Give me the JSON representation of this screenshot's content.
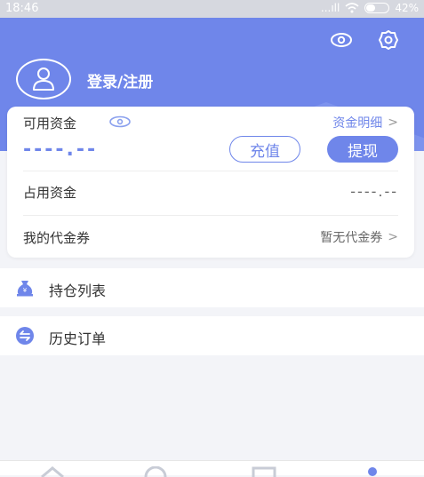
{
  "status_bar": {
    "time": "18:46",
    "signal": "...ıll",
    "battery_text": "42%",
    "battery_level": 0.42
  },
  "header": {
    "login_text": "登录/注册"
  },
  "funds": {
    "available_label": "可用资金",
    "detail_link": "资金明细",
    "available_value": "----.--",
    "recharge_button": "充值",
    "withdraw_button": "提现",
    "occupied_label": "占用资金",
    "occupied_value": "----.--",
    "voucher_label": "我的代金券",
    "voucher_value": "暂无代金券"
  },
  "menu": [
    {
      "label": "持仓列表",
      "icon": "money-bag-icon"
    },
    {
      "label": "历史订单",
      "icon": "swap-icon"
    }
  ],
  "colors": {
    "accent": "#6f86ea",
    "background": "#f3f4f8"
  },
  "tabs": [
    {
      "icon": "home-icon"
    },
    {
      "icon": "trade-icon"
    },
    {
      "icon": "chart-icon"
    },
    {
      "icon": "user-icon"
    }
  ]
}
